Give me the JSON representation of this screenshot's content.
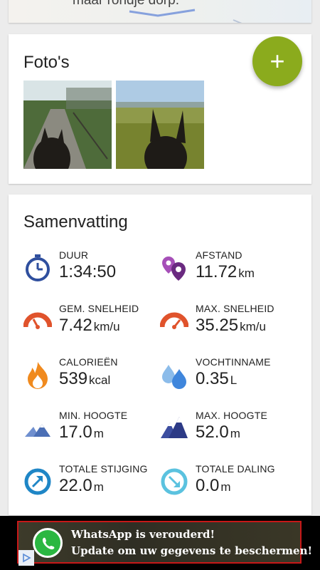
{
  "map_card": {
    "snippet": "maar rondje dorp."
  },
  "photos": {
    "title": "Foto's",
    "add_button_label": "+",
    "items": [
      {
        "alt": "photo-horse-ears-dirt-path"
      },
      {
        "alt": "photo-horse-ears-field"
      }
    ]
  },
  "summary": {
    "title": "Samenvatting",
    "stats": [
      {
        "label": "DUUR",
        "value": "1:34:50",
        "unit": "",
        "icon": "stopwatch-icon",
        "color": "#2f4f9e"
      },
      {
        "label": "AFSTAND",
        "value": "11.72",
        "unit": "km",
        "icon": "location-pins-icon",
        "color": "#7a2e8e"
      },
      {
        "label": "GEM. SNELHEID",
        "value": "7.42",
        "unit": "km/u",
        "icon": "speedometer-icon",
        "color": "#e0532c"
      },
      {
        "label": "MAX. SNELHEID",
        "value": "35.25",
        "unit": "km/u",
        "icon": "speedometer-max-icon",
        "color": "#e0532c"
      },
      {
        "label": "CALORIEËN",
        "value": "539",
        "unit": "kcal",
        "icon": "flame-icon",
        "color": "#f08a1e"
      },
      {
        "label": "VOCHTINNAME",
        "value": "0.35",
        "unit": "L",
        "icon": "water-drops-icon",
        "color": "#4a90e2"
      },
      {
        "label": "MIN. HOOGTE",
        "value": "17.0",
        "unit": "m",
        "icon": "mountain-low-icon",
        "color": "#4b6fb5"
      },
      {
        "label": "MAX. HOOGTE",
        "value": "52.0",
        "unit": "m",
        "icon": "mountain-high-icon",
        "color": "#2c3a86"
      },
      {
        "label": "TOTALE STIJGING",
        "value": "22.0",
        "unit": "m",
        "icon": "ascent-arrow-icon",
        "color": "#1f86c6"
      },
      {
        "label": "TOTALE DALING",
        "value": "0.0",
        "unit": "m",
        "icon": "descent-arrow-icon",
        "color": "#5bc2df"
      }
    ]
  },
  "ad": {
    "line1": "WhatsApp is verouderd!",
    "line2": "Update om uw gegevens te beschermen!"
  }
}
